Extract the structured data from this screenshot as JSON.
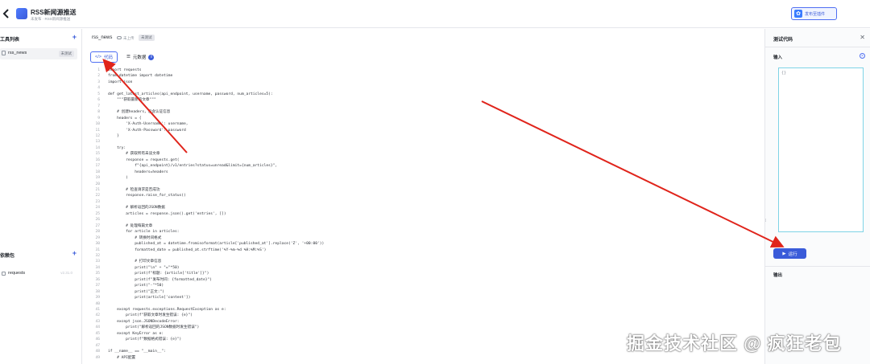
{
  "header": {
    "back_icon": "chevron-left-icon",
    "title": "RSS新闻源推送",
    "subtitle": "未发布 · RSS新闻源推送",
    "publish_label": "发布至插件",
    "accent": "#3a5bd9"
  },
  "sidebar": {
    "tools_heading": "工具列表",
    "tool_item": {
      "name": "rss_news",
      "badge": "未测试"
    },
    "deps_heading": "依赖包",
    "dep_item": {
      "name": "requests",
      "version": "v2.31.0"
    }
  },
  "editor": {
    "file_name": "rss_news",
    "save_state": "未上传",
    "badge": "未测试",
    "tab_code": "代码",
    "tab_meta": "元数据",
    "code_lines": [
      {
        "n": "1",
        "t": "import requests"
      },
      {
        "n": "2",
        "t": "from datetime import datetime"
      },
      {
        "n": "3",
        "t": "import json"
      },
      {
        "n": "4",
        "t": ""
      },
      {
        "n": "5",
        "t": "def get_latest_articles(api_endpoint, username, password, num_articles=5):"
      },
      {
        "n": "6",
        "t": "    \"\"\"获取最新的文章\"\"\""
      },
      {
        "n": "7",
        "t": ""
      },
      {
        "n": "8",
        "t": "    # 创建headers，包含认证信息"
      },
      {
        "n": "9",
        "t": "    headers = {"
      },
      {
        "n": "10",
        "t": "        'X-Auth-Username': username,"
      },
      {
        "n": "11",
        "t": "        'X-Auth-Password': password"
      },
      {
        "n": "12",
        "t": "    }"
      },
      {
        "n": "13",
        "t": ""
      },
      {
        "n": "14",
        "t": "    try:"
      },
      {
        "n": "15",
        "t": "        # 获取所有未读文章"
      },
      {
        "n": "16",
        "t": "        response = requests.get("
      },
      {
        "n": "17",
        "t": "            f\"{api_endpoint}/v1/entries?status=unread&limit={num_articles}\","
      },
      {
        "n": "18",
        "t": "            headers=headers"
      },
      {
        "n": "19",
        "t": "        )"
      },
      {
        "n": "20",
        "t": ""
      },
      {
        "n": "21",
        "t": "        # 检查请求是否成功"
      },
      {
        "n": "22",
        "t": "        response.raise_for_status()"
      },
      {
        "n": "23",
        "t": ""
      },
      {
        "n": "24",
        "t": "        # 解析返回的JSON数据"
      },
      {
        "n": "25",
        "t": "        articles = response.json().get('entries', [])"
      },
      {
        "n": "26",
        "t": ""
      },
      {
        "n": "27",
        "t": "        # 处理每篇文章"
      },
      {
        "n": "28",
        "t": "        for article in articles:"
      },
      {
        "n": "29",
        "t": "            # 转换时间格式"
      },
      {
        "n": "30",
        "t": "            published_at = datetime.fromisoformat(article['published_at'].replace('Z', '+00:00'))"
      },
      {
        "n": "31",
        "t": "            formatted_date = published_at.strftime('%Y-%m-%d %H:%M:%S')"
      },
      {
        "n": "32",
        "t": ""
      },
      {
        "n": "33",
        "t": "            # 打印文章信息"
      },
      {
        "n": "34",
        "t": "            print(\"\\n\" + \"=\"*50)"
      },
      {
        "n": "35",
        "t": "            print(f\"标题: {article['title']}\")"
      },
      {
        "n": "36",
        "t": "            print(f\"发布时间: {formatted_date}\")"
      },
      {
        "n": "37",
        "t": "            print(\"-\"*50)"
      },
      {
        "n": "38",
        "t": "            print(\"正文:\")"
      },
      {
        "n": "39",
        "t": "            print(article['content'])"
      },
      {
        "n": "40",
        "t": ""
      },
      {
        "n": "41",
        "t": "    except requests.exceptions.RequestException as e:"
      },
      {
        "n": "42",
        "t": "        print(f\"获取文章时发生错误: {e}\")"
      },
      {
        "n": "43",
        "t": "    except json.JSONDecodeError:"
      },
      {
        "n": "44",
        "t": "        print(\"解析返回的JSON数据时发生错误\")"
      },
      {
        "n": "45",
        "t": "    except KeyError as e:"
      },
      {
        "n": "46",
        "t": "        print(f\"数据格式错误: {e}\")"
      },
      {
        "n": "47",
        "t": ""
      },
      {
        "n": "48",
        "t": "if __name__ == \"__main__\":"
      },
      {
        "n": "49",
        "t": "    # API配置"
      }
    ]
  },
  "test_panel": {
    "title": "测试代码",
    "close_icon": "close-icon",
    "input_label": "输入",
    "input_value": "{}",
    "run_label": "运行",
    "output_label": "输出"
  },
  "watermark": "掘金技术社区 @ 疯狂老包",
  "colors": {
    "annotation_arrow": "#e0241b",
    "input_border": "#7fd3e6"
  }
}
